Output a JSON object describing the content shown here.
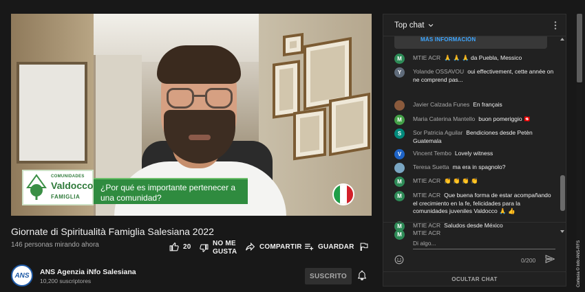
{
  "video": {
    "lower_third": {
      "logo_small": "COMUNIDADES",
      "logo_main": "Valdocco",
      "logo_sub": "FAMIGLIA",
      "caption": "¿Por qué es importante pertenecer a una comunidad?"
    },
    "flag_colors": [
      "#1f9e48",
      "#ffffff",
      "#d3202a"
    ],
    "title": "Giornate di Spiritualità Famiglia Salesiana 2022",
    "views": "146 personas mirando ahora"
  },
  "actions": {
    "like_count": "20",
    "dislike_label": "NO ME GUSTA",
    "dislike_line1": "NO ME",
    "dislike_line2": "GUSTA",
    "share_label": "COMPARTIR",
    "save_label": "GUARDAR"
  },
  "channel": {
    "avatar_text": "ANS",
    "name": "ANS Agenzia iNfo Salesiana",
    "subscribers": "10,200 suscriptores",
    "subscribed_label": "SUSCRITO"
  },
  "chat": {
    "mode_label": "Top chat",
    "banner_text": "MÁS INFORMACIÓN",
    "messages": [
      {
        "initial": "M",
        "color": "#2e8b57",
        "author": "MTIE ACR",
        "text": "🙏 🙏 🙏 da Puebla, Messico"
      },
      {
        "initial": "Y",
        "color": "#5f6b7a",
        "author": "Yolande OSSAVOU",
        "text": "oui effectivement, cette année on ne comprend pas..."
      },
      {
        "initial": "",
        "color": "#8a5a3c",
        "author": "Javier Calzada Funes",
        "text": "En français"
      },
      {
        "initial": "M",
        "color": "#43a047",
        "author": "Maria Caterina Mantello",
        "text": "buon pomeriggio 🇨🇭"
      },
      {
        "initial": "S",
        "color": "#00897b",
        "author": "Sor Patricia Aguilar",
        "text": "Bendiciones desde Petèn Guatemala"
      },
      {
        "initial": "V",
        "color": "#1e63c6",
        "author": "Vincent Tembo",
        "text": "Lovely witness"
      },
      {
        "initial": "",
        "color": "#7aa6c2",
        "author": "Teresa Suetta",
        "text": "ma era in spagnolo?"
      },
      {
        "initial": "M",
        "color": "#2e8b57",
        "author": "MTIE ACR",
        "text": "👏 👏 👏 👏"
      },
      {
        "initial": "M",
        "color": "#2e8b57",
        "author": "MTIE ACR",
        "text": "Que buena forma de estar acompañando el crecimiento en la fe, felicidades para la comunidades juveniles Valdocco 🙏 👍"
      },
      {
        "initial": "M",
        "color": "#2e8b57",
        "author": "MTIE ACR",
        "text": "Saludos desde México"
      }
    ],
    "composer": {
      "initial": "M",
      "name": "MTIE ACR",
      "placeholder": "Di algo...",
      "counter": "0/200"
    },
    "hide_label": "OCULTAR CHAT"
  },
  "credit": "Cortesía © Info ANS-RFS"
}
